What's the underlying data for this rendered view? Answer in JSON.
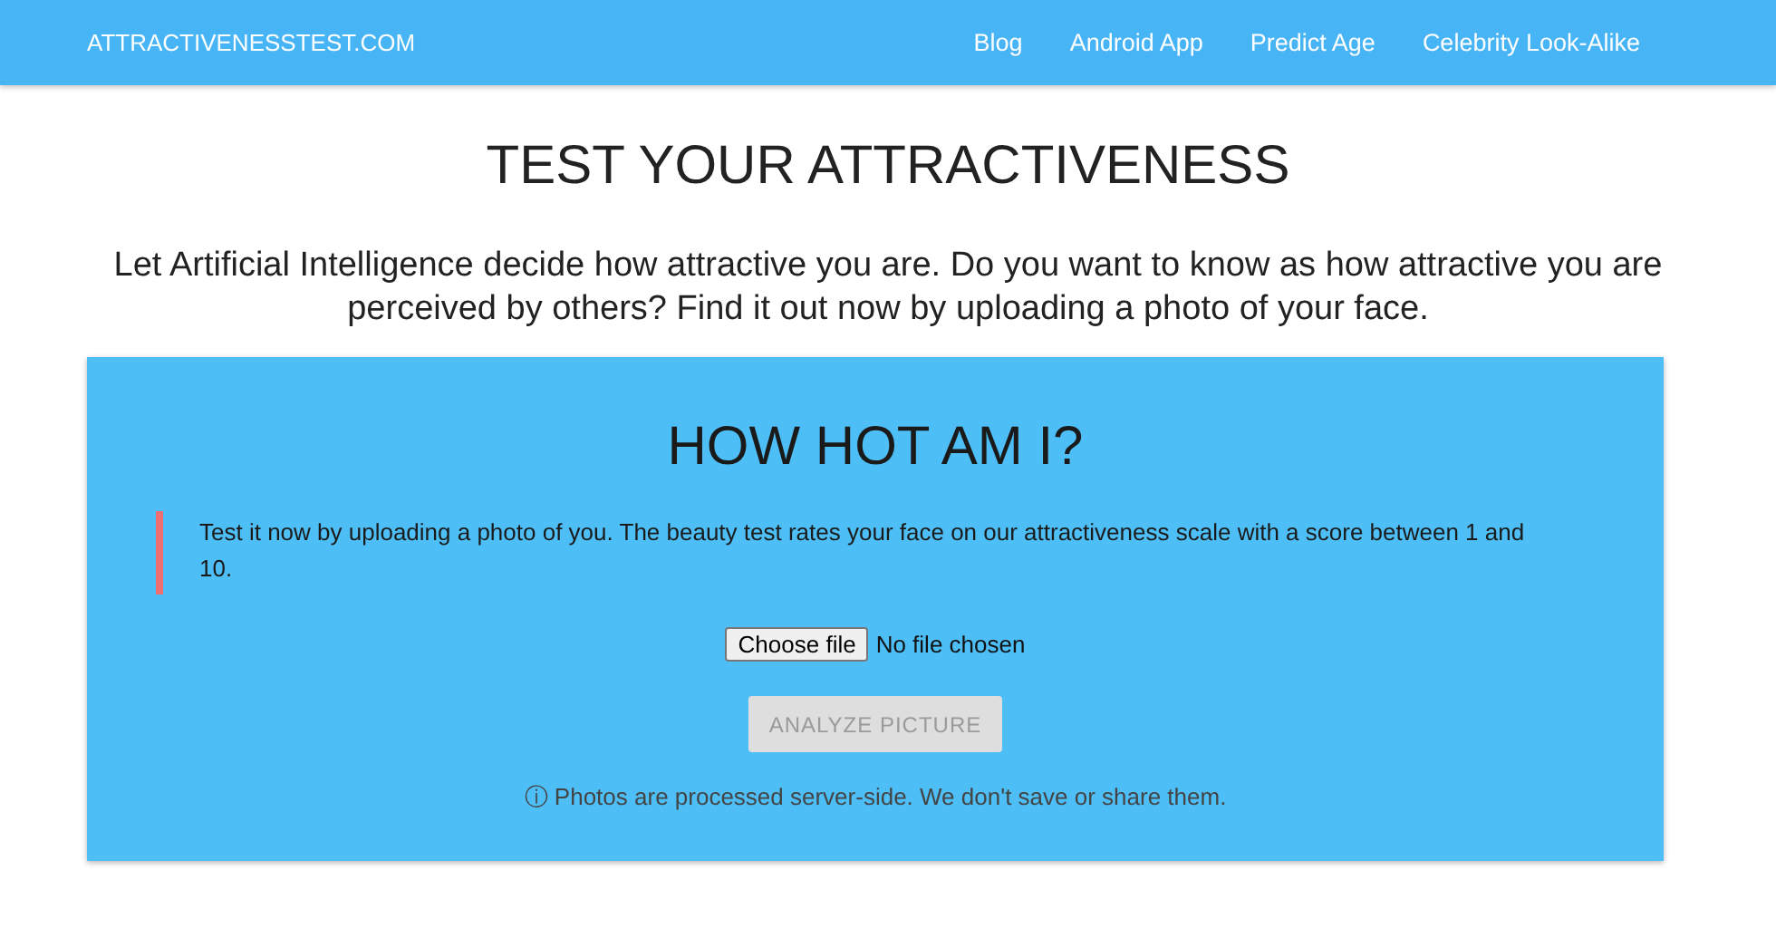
{
  "navbar": {
    "brand": "ATTRACTIVENESSTEST.COM",
    "links": [
      "Blog",
      "Android App",
      "Predict Age",
      "Celebrity Look-Alike"
    ]
  },
  "title": "TEST YOUR ATTRACTIVENESS",
  "intro": "Let Artificial Intelligence decide how attractive you are. Do you want to know as how attractive you are perceived by others? Find it out now by uploading a photo of your face.",
  "card": {
    "heading": "HOW HOT AM I?",
    "quote": "Test it now by uploading a photo of you. The beauty test rates your face on our attractiveness scale with a score between 1 and 10.",
    "file_button": "Choose file",
    "file_status": "No file chosen",
    "analyze_button": {
      "label": "ANALYZE PICTURE",
      "disabled": true
    },
    "note": "ⓘ Photos are processed server-side. We don't save or share them."
  }
}
